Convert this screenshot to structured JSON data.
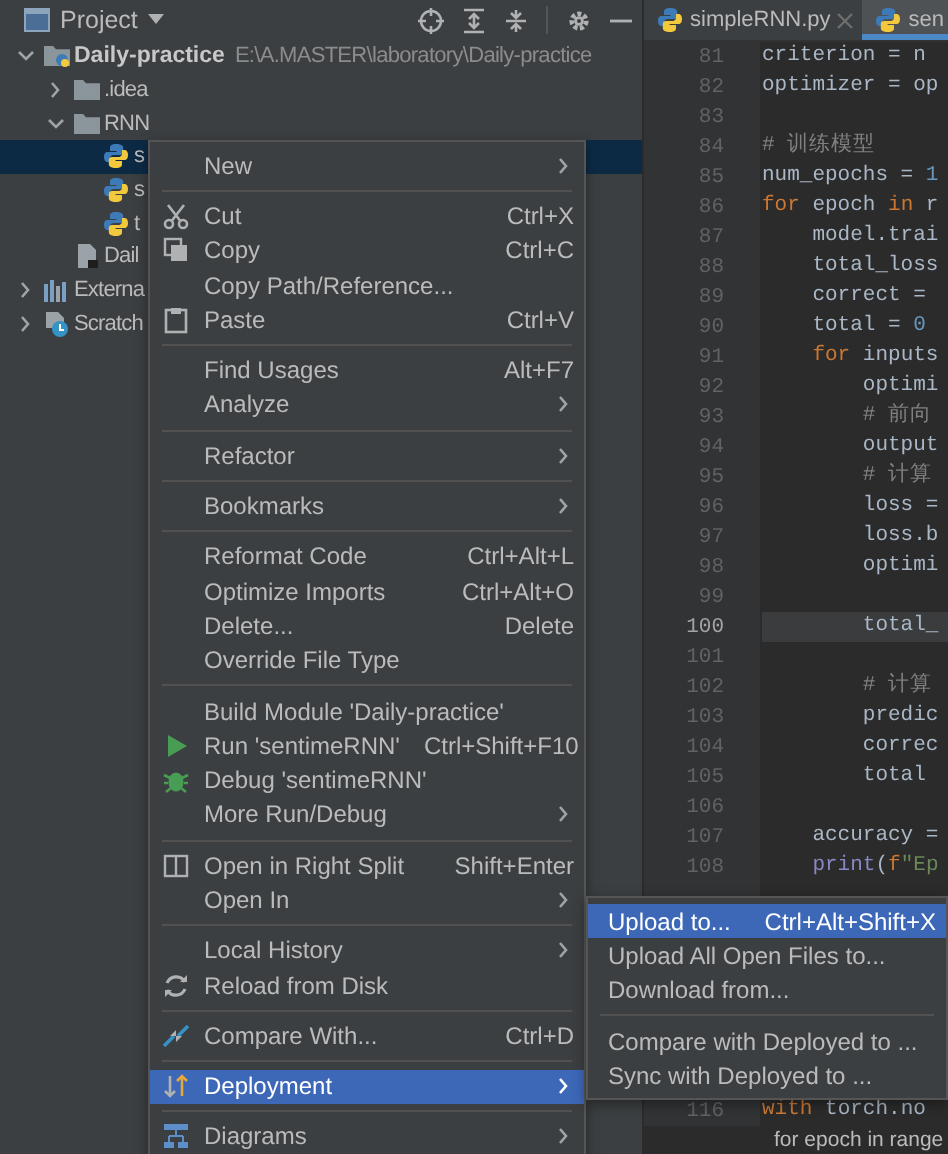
{
  "project": {
    "title": "Project",
    "tree": [
      {
        "label": "Daily-practice",
        "path": "E:\\A.MASTER\\laboratory\\Daily-practice",
        "kind": "project",
        "expanded": true,
        "selected": false,
        "children": [
          {
            "label": ".idea",
            "kind": "folder",
            "expanded": false,
            "selected": false
          },
          {
            "label": "RNN",
            "kind": "folder",
            "expanded": true,
            "selected": false,
            "children": [
              {
                "label": "s",
                "kind": "python",
                "selected": true
              },
              {
                "label": "s",
                "kind": "python",
                "selected": false
              },
              {
                "label": "t",
                "kind": "python",
                "selected": false
              }
            ]
          },
          {
            "label": "Dail",
            "kind": "file",
            "selected": false
          }
        ]
      },
      {
        "label": "Externa",
        "kind": "library",
        "expanded": false,
        "selected": false
      },
      {
        "label": "Scratch",
        "kind": "scratch",
        "expanded": false,
        "selected": false
      }
    ]
  },
  "editor": {
    "tabs": [
      {
        "label": "simpleRNN.py",
        "selected": false
      },
      {
        "label": "sen",
        "selected": true
      }
    ],
    "lines": [
      {
        "number": "81",
        "current": false,
        "parts": [
          {
            "text": "criterion = n",
            "kind": "plain"
          }
        ]
      },
      {
        "number": "82",
        "current": false,
        "parts": [
          {
            "text": "optimizer = op",
            "kind": "plain"
          }
        ]
      },
      {
        "number": "83",
        "current": false
      },
      {
        "number": "84",
        "current": false,
        "parts": [
          {
            "text": "# 训练模型",
            "kind": "comment"
          }
        ]
      },
      {
        "number": "85",
        "current": false,
        "parts": [
          {
            "text": "num_epochs = ",
            "kind": "plain"
          },
          {
            "text": "1",
            "kind": "number"
          }
        ]
      },
      {
        "number": "86",
        "current": false,
        "parts": [
          {
            "text": "for",
            "kind": "keyword"
          },
          {
            "text": " epoch ",
            "kind": "plain"
          },
          {
            "text": "in",
            "kind": "keyword"
          },
          {
            "text": " r",
            "kind": "plain"
          }
        ]
      },
      {
        "number": "87",
        "current": false,
        "parts": [
          {
            "text": "    model.trai",
            "kind": "plain"
          }
        ]
      },
      {
        "number": "88",
        "current": false,
        "parts": [
          {
            "text": "    total_loss",
            "kind": "plain"
          }
        ]
      },
      {
        "number": "89",
        "current": false,
        "parts": [
          {
            "text": "    correct =",
            "kind": "plain"
          }
        ]
      },
      {
        "number": "90",
        "current": false,
        "parts": [
          {
            "text": "    total = ",
            "kind": "plain"
          },
          {
            "text": "0",
            "kind": "number"
          }
        ]
      },
      {
        "number": "91",
        "current": false,
        "parts": [
          {
            "text": "    for",
            "kind": "keyword"
          },
          {
            "text": " inputs",
            "kind": "plain"
          }
        ]
      },
      {
        "number": "92",
        "current": false,
        "parts": [
          {
            "text": "        optimi",
            "kind": "plain"
          }
        ]
      },
      {
        "number": "93",
        "current": false,
        "parts": [
          {
            "text": "        # 前向",
            "kind": "comment"
          }
        ]
      },
      {
        "number": "94",
        "current": false,
        "parts": [
          {
            "text": "        output",
            "kind": "plain"
          }
        ]
      },
      {
        "number": "95",
        "current": false,
        "parts": [
          {
            "text": "        # 计算",
            "kind": "comment"
          }
        ]
      },
      {
        "number": "96",
        "current": false,
        "parts": [
          {
            "text": "        loss =",
            "kind": "plain"
          }
        ]
      },
      {
        "number": "97",
        "current": false,
        "parts": [
          {
            "text": "        loss.b",
            "kind": "plain"
          }
        ]
      },
      {
        "number": "98",
        "current": false,
        "parts": [
          {
            "text": "        optimi",
            "kind": "plain"
          }
        ]
      },
      {
        "number": "99",
        "current": false
      },
      {
        "number": "100",
        "current": true,
        "parts": [
          {
            "text": "        total_",
            "kind": "plain"
          }
        ]
      },
      {
        "number": "101",
        "current": false
      },
      {
        "number": "102",
        "current": false,
        "parts": [
          {
            "text": "        # 计算",
            "kind": "comment"
          }
        ]
      },
      {
        "number": "103",
        "current": false,
        "parts": [
          {
            "text": "        predic",
            "kind": "plain"
          }
        ]
      },
      {
        "number": "104",
        "current": false,
        "parts": [
          {
            "text": "        correc",
            "kind": "plain"
          }
        ]
      },
      {
        "number": "105",
        "current": false,
        "parts": [
          {
            "text": "        total",
            "kind": "plain"
          }
        ]
      },
      {
        "number": "106",
        "current": false
      },
      {
        "number": "107",
        "current": false,
        "parts": [
          {
            "text": "    accuracy =",
            "kind": "plain"
          }
        ]
      },
      {
        "number": "108",
        "current": false,
        "parts": [
          {
            "text": "    print",
            "kind": "builtin"
          },
          {
            "text": "(",
            "kind": "plain"
          },
          {
            "text": "f",
            "kind": "keyword"
          },
          {
            "text": "\"Ep",
            "kind": "string"
          }
        ]
      }
    ],
    "lower_lines": [
      {
        "number": "116",
        "current": false,
        "parts": [
          {
            "text": "with",
            "kind": "keyword"
          },
          {
            "text": " torch.no",
            "kind": "plain"
          }
        ]
      }
    ],
    "breadcrumb": "for epoch in range"
  },
  "context_menu": {
    "groups": [
      {
        "items": [
          {
            "label": "New",
            "submenu": true,
            "selected": false
          }
        ]
      },
      {
        "items": [
          {
            "label": "Cut",
            "shortcut": "Ctrl+X",
            "submenu": false,
            "selected": false
          },
          {
            "label": "Copy",
            "shortcut": "Ctrl+C",
            "submenu": false,
            "selected": false
          },
          {
            "label": "Copy Path/Reference...",
            "submenu": false,
            "selected": false
          },
          {
            "label": "Paste",
            "shortcut": "Ctrl+V",
            "submenu": false,
            "selected": false
          }
        ]
      },
      {
        "items": [
          {
            "label": "Find Usages",
            "shortcut": "Alt+F7",
            "submenu": false,
            "selected": false
          },
          {
            "label": "Analyze",
            "submenu": true,
            "selected": false
          }
        ]
      },
      {
        "items": [
          {
            "label": "Refactor",
            "submenu": true,
            "selected": false
          }
        ]
      },
      {
        "items": [
          {
            "label": "Bookmarks",
            "submenu": true,
            "selected": false
          }
        ]
      },
      {
        "items": [
          {
            "label": "Reformat Code",
            "shortcut": "Ctrl+Alt+L",
            "submenu": false,
            "selected": false
          },
          {
            "label": "Optimize Imports",
            "shortcut": "Ctrl+Alt+O",
            "submenu": false,
            "selected": false
          },
          {
            "label": "Delete...",
            "shortcut": "Delete",
            "submenu": false,
            "selected": false
          },
          {
            "label": "Override File Type",
            "submenu": false,
            "selected": false
          }
        ]
      },
      {
        "items": [
          {
            "label": "Build Module 'Daily-practice'",
            "submenu": false,
            "selected": false
          },
          {
            "label": "Run 'sentimeRNN'",
            "shortcut": "Ctrl+Shift+F10",
            "submenu": false,
            "selected": false
          },
          {
            "label": "Debug 'sentimeRNN'",
            "submenu": false,
            "selected": false
          },
          {
            "label": "More Run/Debug",
            "submenu": true,
            "selected": false
          }
        ]
      },
      {
        "items": [
          {
            "label": "Open in Right Split",
            "shortcut": "Shift+Enter",
            "submenu": false,
            "selected": false
          },
          {
            "label": "Open In",
            "submenu": true,
            "selected": false
          }
        ]
      },
      {
        "items": [
          {
            "label": "Local History",
            "submenu": true,
            "selected": false
          },
          {
            "label": "Reload from Disk",
            "submenu": false,
            "selected": false
          }
        ]
      },
      {
        "items": [
          {
            "label": "Compare With...",
            "shortcut": "Ctrl+D",
            "submenu": false,
            "selected": false
          }
        ]
      },
      {
        "items": [
          {
            "label": "Deployment",
            "submenu": true,
            "selected": true
          }
        ]
      },
      {
        "items": [
          {
            "label": "Diagrams",
            "submenu": true,
            "selected": false
          }
        ]
      }
    ]
  },
  "deployment_menu": {
    "groups": [
      {
        "items": [
          {
            "label": "Upload to...",
            "shortcut": "Ctrl+Alt+Shift+X",
            "submenu": false,
            "selected": true
          },
          {
            "label": "Upload All Open Files to...",
            "submenu": false,
            "selected": false
          },
          {
            "label": "Download from...",
            "submenu": false,
            "selected": false
          }
        ]
      },
      {
        "items": [
          {
            "label": "Compare with Deployed to ...",
            "submenu": false,
            "selected": false
          },
          {
            "label": "Sync with Deployed to ...",
            "submenu": false,
            "selected": false
          }
        ]
      }
    ]
  }
}
